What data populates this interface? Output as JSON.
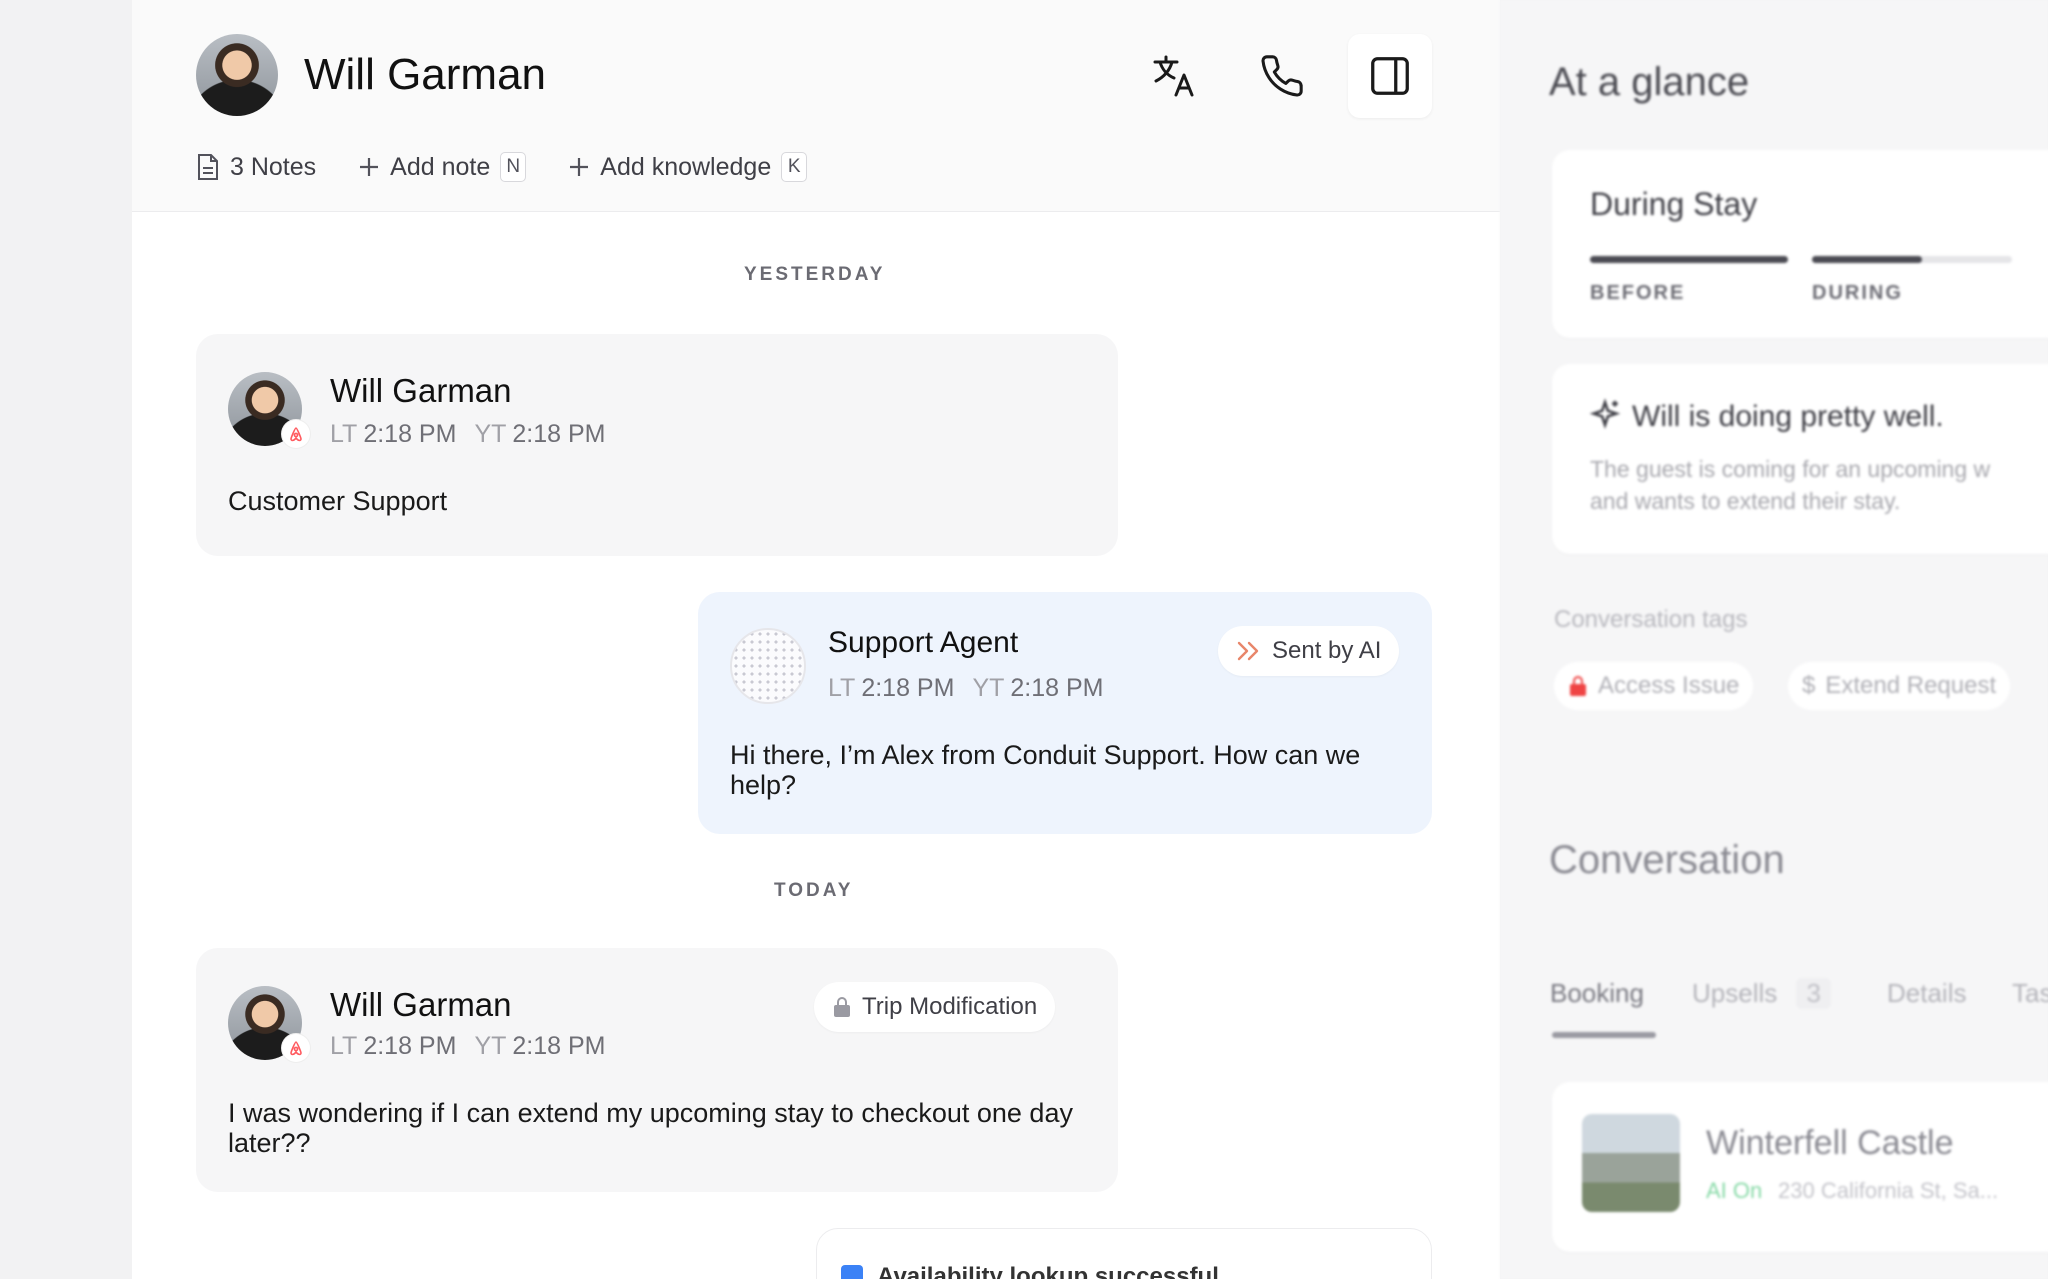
{
  "header": {
    "name": "Will Garman",
    "notes_label": "3 Notes",
    "add_note_label": "Add note",
    "add_note_key": "N",
    "add_knowledge_label": "Add knowledge",
    "add_knowledge_key": "K"
  },
  "dividers": {
    "yesterday": "YESTERDAY",
    "today": "TODAY"
  },
  "messages": [
    {
      "sender": "Will Garman",
      "lt_prefix": "LT",
      "lt_time": "2:18 PM",
      "yt_prefix": "YT",
      "yt_time": "2:18 PM",
      "body": "Customer Support"
    },
    {
      "sender": "Support Agent",
      "lt_prefix": "LT",
      "lt_time": "2:18 PM",
      "yt_prefix": "YT",
      "yt_time": "2:18 PM",
      "badge": "Sent by AI",
      "body": "Hi there, I’m Alex from Conduit Support. How can we help?"
    },
    {
      "sender": "Will Garman",
      "lt_prefix": "LT",
      "lt_time": "2:18 PM",
      "yt_prefix": "YT",
      "yt_time": "2:18 PM",
      "tag": "Trip Modification",
      "body": "I was wondering if I can extend my upcoming stay to checkout one day later??"
    },
    {
      "body": "Availability lookup successful"
    }
  ],
  "panel": {
    "title": "At a glance",
    "stay_card": {
      "title": "During Stay",
      "stages": [
        "BEFORE",
        "DURING"
      ],
      "stage_progress": [
        1.0,
        0.55
      ]
    },
    "summary": {
      "headline": "Will is doing pretty well.",
      "text_line1": "The guest is coming for an upcoming w",
      "text_line2": "and wants to extend their stay."
    },
    "tags_title": "Conversation tags",
    "tags": [
      "Access Issue",
      "Extend Request"
    ],
    "conversation_title": "Conversation",
    "tabs": [
      "Booking",
      "Upsells",
      "Details",
      "Tas"
    ],
    "upsells_count": "3",
    "listing": {
      "name": "Winterfell Castle",
      "ai_status": "AI On",
      "address": "230 California St, Sa..."
    }
  },
  "colors": {
    "accent_blue_bubble": "#eef4fd",
    "ai_badge": "#e8866a",
    "airbnb": "#ff5a5f",
    "lock_red": "#ef4444",
    "ai_on": "#22c55e"
  }
}
